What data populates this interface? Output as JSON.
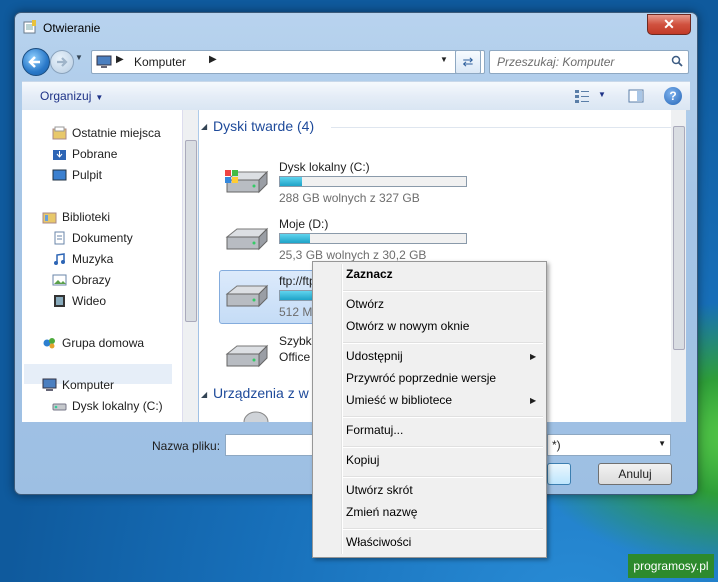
{
  "window": {
    "title": "Otwieranie",
    "close_label": "✕"
  },
  "address": {
    "path": "Komputer",
    "search_placeholder": "Przeszukaj: Komputer"
  },
  "toolbar": {
    "organize": "Organizuj"
  },
  "nav": {
    "items": [
      {
        "label": "Ostatnie miejsca",
        "icon": "recent-places-icon"
      },
      {
        "label": "Pobrane",
        "icon": "downloads-icon"
      },
      {
        "label": "Pulpit",
        "icon": "desktop-icon"
      },
      {
        "label": "Biblioteki",
        "icon": "libraries-icon"
      },
      {
        "label": "Dokumenty",
        "icon": "documents-icon"
      },
      {
        "label": "Muzyka",
        "icon": "music-icon"
      },
      {
        "label": "Obrazy",
        "icon": "pictures-icon"
      },
      {
        "label": "Wideo",
        "icon": "videos-icon"
      },
      {
        "label": "Grupa domowa",
        "icon": "homegroup-icon"
      },
      {
        "label": "Komputer",
        "icon": "computer-icon"
      },
      {
        "label": "Dysk lokalny (C:)",
        "icon": "drive-icon"
      }
    ]
  },
  "content": {
    "group1": "Dyski twarde (4)",
    "group2": "Urządzenia z w",
    "drives": [
      {
        "name": "Dysk lokalny (C:)",
        "free": "288 GB wolnych z 327 GB",
        "used_fraction": 0.12
      },
      {
        "name": "Moje (D:)",
        "free": "25,3 GB wolnych z 30,2 GB",
        "used_fraction": 0.16
      },
      {
        "name": "ftp://ftp.",
        "free": "512 MB w",
        "used_fraction": 0.25
      },
      {
        "name": "Szybka in",
        "free": "Office 20",
        "used_fraction": 0
      }
    ]
  },
  "bottom": {
    "filename_label": "Nazwa pliku:",
    "type_value": "*)",
    "cancel": "Anuluj"
  },
  "context_menu": {
    "select": "Zaznacz",
    "open": "Otwórz",
    "open_new_window": "Otwórz w nowym oknie",
    "share": "Udostępnij",
    "restore": "Przywróć poprzednie wersje",
    "include_library": "Umieść w bibliotece",
    "format": "Formatuj...",
    "copy": "Kopiuj",
    "create_shortcut": "Utwórz skrót",
    "rename": "Zmień nazwę",
    "properties": "Właściwości"
  },
  "watermark": "programosy.pl"
}
